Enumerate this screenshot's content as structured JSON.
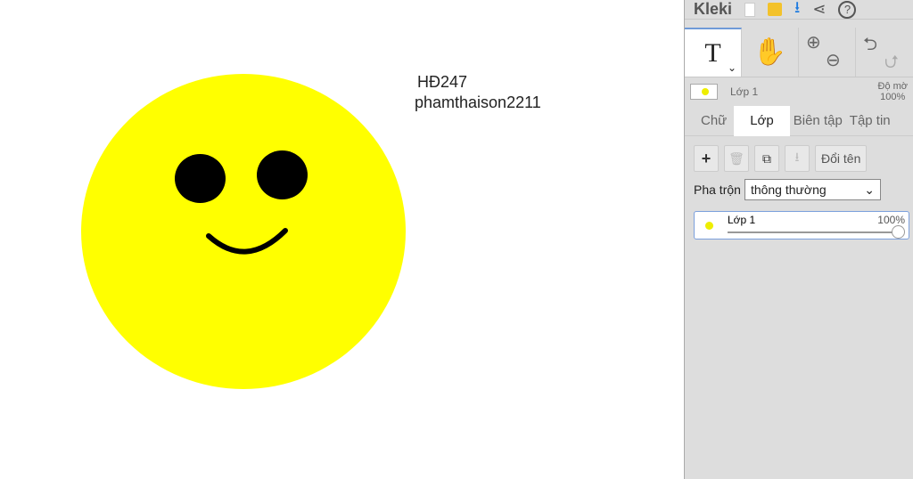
{
  "canvas": {
    "text1": "HĐ247",
    "text2": "phamthaison2211"
  },
  "panel": {
    "app_name": "Kleki",
    "active_layer": "Lớp 1",
    "opacity_label": "Độ mờ",
    "opacity_value": "100%",
    "tabs": [
      "Chữ",
      "Lớp",
      "Biên tập",
      "Tập tin"
    ],
    "rename_label": "Đổi tên",
    "blend_label": "Pha trộn",
    "blend_value": "thông thường",
    "layers": [
      {
        "name": "Lớp 1",
        "opacity": "100%",
        "opacity_fraction": 1.0
      }
    ]
  }
}
